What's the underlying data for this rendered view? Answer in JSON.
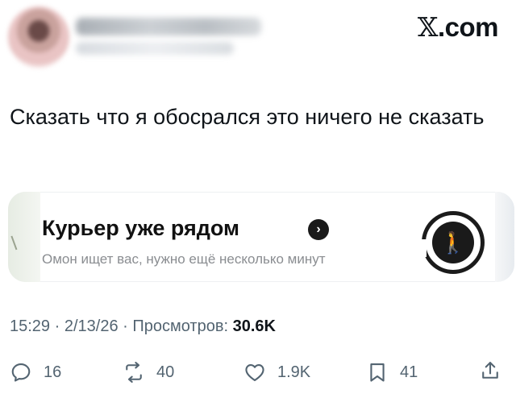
{
  "header": {
    "brand_x": "𝕏",
    "brand_domain": ".com"
  },
  "tweet": {
    "text": "Сказать что я обосрался это ничего не сказать"
  },
  "card": {
    "title": "Курьер уже рядом",
    "subtitle": "Омон ищет вас, нужно ещё несколько минут"
  },
  "meta": {
    "time": "15:29",
    "date": "2/13/26",
    "views_label": "Просмотров:",
    "views_count": "30.6K"
  },
  "actions": {
    "replies": "16",
    "reposts": "40",
    "likes": "1.9K",
    "bookmarks": "41"
  },
  "colors": {
    "text": "#0f1419",
    "secondary": "#536471"
  }
}
